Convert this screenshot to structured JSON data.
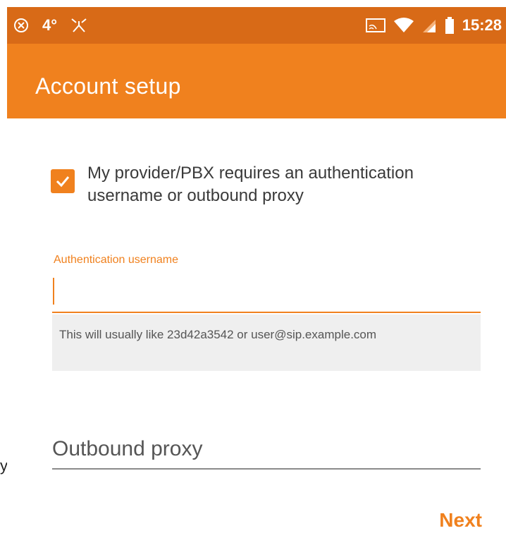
{
  "status_bar": {
    "temperature": "4°",
    "time": "15:28",
    "icons": [
      "close-circle-icon",
      "activity-icon",
      "cast-icon",
      "wifi-icon",
      "signal-icon",
      "battery-icon"
    ]
  },
  "app_bar": {
    "title": "Account setup"
  },
  "auth_checkbox": {
    "checked": true,
    "label": "My provider/PBX requires an authentication username or outbound proxy"
  },
  "auth_username": {
    "label": "Authentication username",
    "value": "",
    "hint": "This will usually like 23d42a3542 or user@sip.example.com"
  },
  "outbound_proxy": {
    "placeholder": "Outbound proxy",
    "value": ""
  },
  "actions": {
    "next_label": "Next"
  },
  "colors": {
    "status_bar": "#d86a17",
    "app_bar": "#f0811e",
    "accent": "#f0811e"
  },
  "side_glyph": "y"
}
